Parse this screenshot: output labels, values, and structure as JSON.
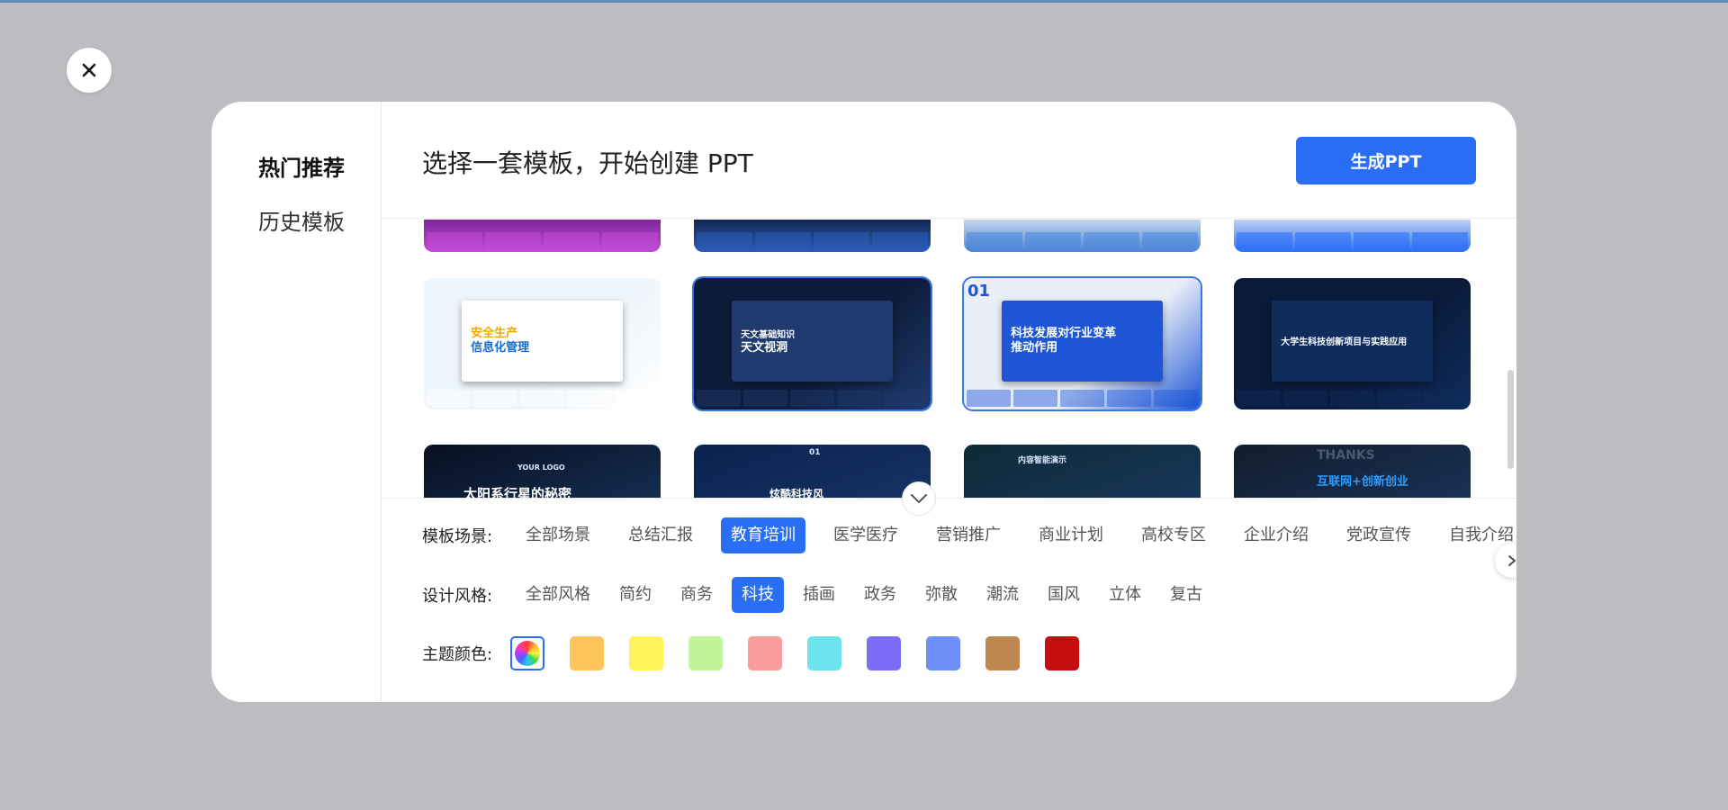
{
  "sidebar": {
    "items": [
      {
        "label": "热门推荐",
        "active": true
      },
      {
        "label": "历史模板",
        "active": false
      }
    ]
  },
  "header": {
    "title": "选择一套模板，开始创建 PPT",
    "generate_label": "生成PPT"
  },
  "templates": {
    "row_top_partial": [
      {
        "bg": "#6e1f8c",
        "accent": "#c24ad8"
      },
      {
        "bg": "#0d1b3d",
        "accent": "#2a5db8"
      },
      {
        "bg": "#dfe8f3",
        "accent": "#4a86d8"
      },
      {
        "bg": "#dfe8f3",
        "accent": "#2a6ef5"
      }
    ],
    "row_middle": [
      {
        "t1": "安全生产",
        "t1b": "信息化管理",
        "t2": "",
        "bg": "#eef5fb",
        "panel": "#ffffff",
        "text": "#f0a800",
        "text2": "#1a6ccc",
        "selected": false
      },
      {
        "t1": "天文视洞",
        "t1b": "",
        "t2": "天文基础知识",
        "bg": "#0d1c3a",
        "panel": "#1f3a6e",
        "text": "#ffffff",
        "text2": "#ffffff",
        "selected": true
      },
      {
        "t1": "科技发展对行业变革",
        "t1b": "推动作用",
        "t2": "01",
        "bg": "#e9eef7",
        "panel": "#1d55d6",
        "text": "#ffffff",
        "text2": "#1d55d6",
        "selected": true
      },
      {
        "t1": "大学生科技创新项目与实践应用",
        "t1b": "",
        "t2": "",
        "bg": "#0a1a3a",
        "panel": "#0f2c5c",
        "text": "#ffffff",
        "text2": "#ffffff",
        "selected": false
      }
    ],
    "row_bottom": [
      {
        "t1": "太阳系行星的秘密",
        "t2": "YOUR LOGO",
        "bg": "#07101f",
        "text": "#ffffff"
      },
      {
        "t1": "炫酷科技风",
        "t2": "01",
        "bg": "#0a2250",
        "text": "#ffffff"
      },
      {
        "t1": "内容智能演示",
        "t2": "",
        "bg": "#0d2a35",
        "text": "#bfe3ff"
      },
      {
        "t1": "互联网+创新创业",
        "t2": "THANKS",
        "bg": "#121d2b",
        "text": "#2e9bff"
      }
    ]
  },
  "filters": {
    "scene_label": "模板场景:",
    "scene_options": [
      "全部场景",
      "总结汇报",
      "教育培训",
      "医学医疗",
      "营销推广",
      "商业计划",
      "高校专区",
      "企业介绍",
      "党政宣传",
      "自我介绍"
    ],
    "scene_active": 2,
    "style_label": "设计风格:",
    "style_options": [
      "全部风格",
      "简约",
      "商务",
      "科技",
      "插画",
      "政务",
      "弥散",
      "潮流",
      "国风",
      "立体",
      "复古"
    ],
    "style_active": 3,
    "color_label": "主题颜色:",
    "colors": [
      "#ffc35c",
      "#fff35c",
      "#c2f59b",
      "#fc9c9c",
      "#6de3ee",
      "#7d6cf9",
      "#6c8ff9",
      "#bd874f",
      "#c40e0e"
    ]
  }
}
